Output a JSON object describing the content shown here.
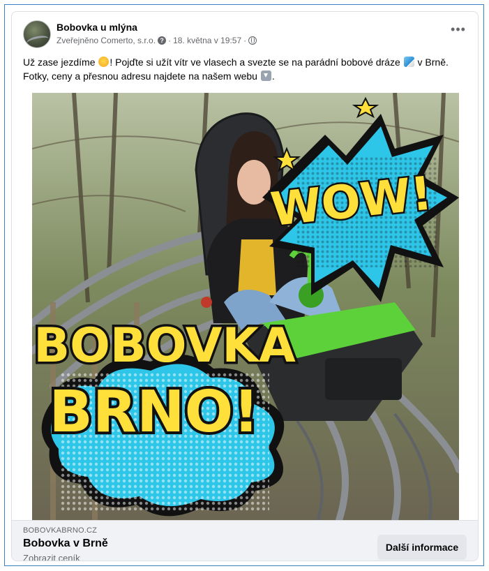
{
  "post": {
    "page_name": "Bobovka u mlýna",
    "sponsor": "Zveřejněno Comerto, s.r.o.",
    "separator": "·",
    "date": "18. května v 19:57",
    "more": "•••",
    "text_line1_a": "Už zase jezdíme ",
    "text_line1_b": "! Pojďte si užít vítr ve vlasech a svezte se na parádní bobové dráze ",
    "text_line1_c": " v Brně.",
    "text_line2_a": "Fotky, ceny a přesnou adresu najdete na našem webu ",
    "text_line2_b": "."
  },
  "image": {
    "sticker_wow": "WOW!",
    "sticker_line1": "BOBOVKA",
    "sticker_line2": "BRNO!"
  },
  "link": {
    "domain": "BOBOVKABRNO.CZ",
    "title": "Bobovka v Brně",
    "subtitle": "Zobrazit ceník",
    "cta": "Další informace"
  },
  "icons": {
    "question": "question-circle-icon",
    "globe": "globe-icon",
    "laugh": "rolling-laugh-emoji",
    "rail": "mountain-railway-emoji",
    "down": "down-arrow-emoji"
  },
  "colors": {
    "accent_blue": "#3b82c4",
    "cta_bg": "#e4e6eb",
    "link_bg": "#f0f2f5",
    "sticker_yellow": "#ffe03a",
    "sticker_cyan": "#2ec6e8",
    "sled_green": "#5cd13a"
  }
}
